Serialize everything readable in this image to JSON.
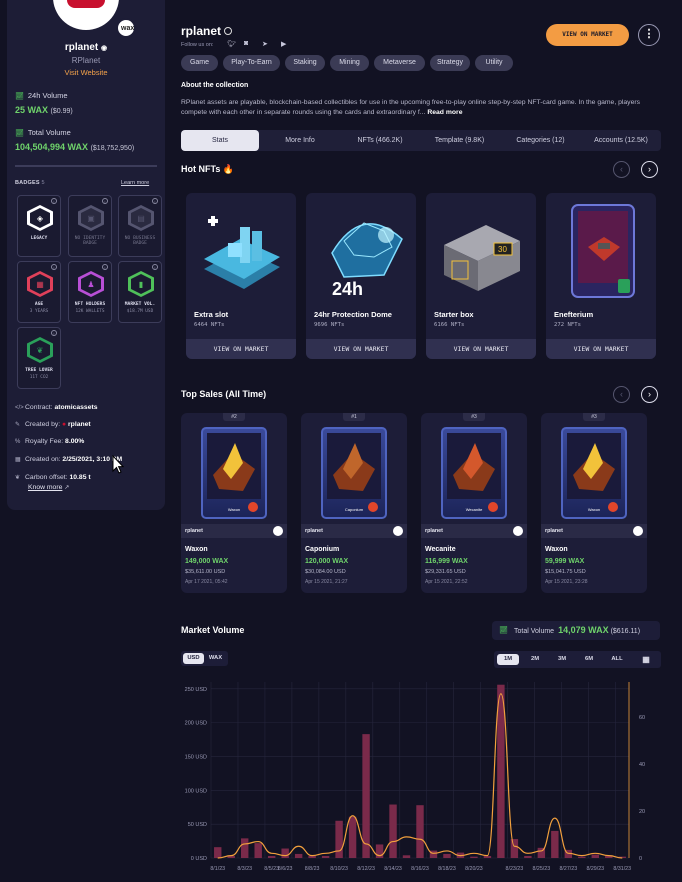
{
  "sidebar": {
    "name": "rplanet",
    "subtitle": "RPlanet",
    "website": "Visit Website",
    "stats": [
      {
        "label": "24h Volume",
        "value": "25 WAX",
        "usd": "($0.99)"
      },
      {
        "label": "Total Volume",
        "value": "104,504,994 WAX",
        "usd": "($18,752,950)"
      }
    ],
    "badges_title": "BADGES",
    "badges_count": "5",
    "learn_more": "Learn more",
    "badges": [
      {
        "label": "LEGACY",
        "sub": "",
        "icon": "legacy-icon",
        "color": "#ffffff",
        "active": true
      },
      {
        "label": "NO IDENTITY BADGE",
        "sub": "",
        "icon": "identity-icon",
        "color": "#555570",
        "active": false
      },
      {
        "label": "NO BUSINESS BADGE",
        "sub": "",
        "icon": "business-icon",
        "color": "#555570",
        "active": false
      },
      {
        "label": "AGE",
        "sub": "3 YEARS",
        "icon": "calendar-icon",
        "color": "#e0405a",
        "active": true
      },
      {
        "label": "NFT HOLDERS",
        "sub": "12K WALLETS",
        "icon": "holders-icon",
        "color": "#b84fd6",
        "active": true
      },
      {
        "label": "MARKET VOL.",
        "sub": "$18.7M USD",
        "icon": "chart-up-icon",
        "color": "#4fc05a",
        "active": true
      },
      {
        "label": "TREE LOVER",
        "sub": "11T CO2",
        "icon": "leaf-icon",
        "color": "#2aa05a",
        "active": true
      }
    ],
    "meta": {
      "contract_label": "Contract:",
      "contract": "atomicassets",
      "created_by_label": "Created by:",
      "created_by": "rplanet",
      "royalty_label": "Royalty Fee:",
      "royalty": "8.00%",
      "created_on_label": "Created on:",
      "created_on": "2/25/2021, 3:10 PM",
      "carbon_label": "Carbon offset:",
      "carbon": "10.85 t",
      "know_more": "Know more"
    }
  },
  "header": {
    "title": "rplanet",
    "follow": "Follow us on:",
    "view_market": "VIEW ON MARKET",
    "more": "⋮",
    "tags": [
      "Game",
      "Play-To-Earn",
      "Staking",
      "Mining",
      "Metaverse",
      "Strategy",
      "Utility"
    ]
  },
  "about": {
    "heading": "About the collection",
    "text": "RPlanet assets are playable, blockchain-based collectibles for use in the upcoming free-to-play online step-by-step NFT-card game. In the game, players compete with each other in separate rounds using the cards and extraordinary f...",
    "read_more": "Read more"
  },
  "tabs": [
    "Stats",
    "More Info",
    "NFTs (466.2K)",
    "Template (9.8K)",
    "Categories (12)",
    "Accounts (12.5K)"
  ],
  "hot": {
    "heading": "Hot NFTs 🔥",
    "cards": [
      {
        "name": "Extra slot",
        "count": "6464 NFTs",
        "button": "VIEW ON MARKET"
      },
      {
        "name": "24hr Protection Dome",
        "count": "9696 NFTs",
        "button": "VIEW ON MARKET"
      },
      {
        "name": "Starter box",
        "count": "6166 NFTs",
        "button": "VIEW ON MARKET"
      },
      {
        "name": "Enefterium",
        "count": "272 NFTs",
        "button": "VIEW ON MARKET"
      }
    ]
  },
  "sales": {
    "heading": "Top Sales (All Time)",
    "items": [
      {
        "rank": "#2",
        "collection": "rplanet",
        "name": "Waxon",
        "wax": "149,000 WAX",
        "usd": "$35,611.00 USD",
        "date": "Apr 17 2021, 05:42",
        "card_label": "Waxon"
      },
      {
        "rank": "#1",
        "collection": "rplanet",
        "name": "Caponium",
        "wax": "120,000 WAX",
        "usd": "$30,084.00 USD",
        "date": "Apr 15 2021, 21:27",
        "card_label": "Caponium"
      },
      {
        "rank": "#3",
        "collection": "rplanet",
        "name": "Wecanite",
        "wax": "116,999 WAX",
        "usd": "$29,331.65 USD",
        "date": "Apr 15 2021, 22:52",
        "card_label": "Wecanite"
      },
      {
        "rank": "#3",
        "collection": "rplanet",
        "name": "Waxon",
        "wax": "59,999 WAX",
        "usd": "$15,041.75 USD",
        "date": "Apr 15 2021, 23:28",
        "card_label": "Waxon"
      }
    ]
  },
  "market": {
    "heading": "Market Volume",
    "total_label": "Total Volume",
    "total_wax": "14,079 WAX",
    "total_usd": "($616.11)",
    "currency": [
      "USD",
      "WAX"
    ],
    "ranges": [
      "1M",
      "2M",
      "3M",
      "6M",
      "ALL"
    ]
  },
  "chart_data": {
    "type": "bar",
    "categories": [
      "8/1/23",
      "8/2/23",
      "8/3/23",
      "8/4/23",
      "8/5/23",
      "8/6/23",
      "8/7/23",
      "8/8/23",
      "8/9/23",
      "8/10/23",
      "8/11/23",
      "8/12/23",
      "8/13/23",
      "8/14/23",
      "8/15/23",
      "8/16/23",
      "8/17/23",
      "8/18/23",
      "8/19/23",
      "8/20/23",
      "8/21/23",
      "8/22/23",
      "8/23/23",
      "8/24/23",
      "8/25/23",
      "8/26/23",
      "8/27/23",
      "8/28/23",
      "8/29/23",
      "8/30/23",
      "8/31/23"
    ],
    "series": [
      {
        "name": "USD",
        "type": "bar",
        "values": [
          16,
          3,
          29,
          22,
          3,
          14,
          6,
          3,
          3,
          55,
          61,
          183,
          20,
          79,
          4,
          78,
          11,
          6,
          8,
          2,
          3,
          256,
          28,
          3,
          15,
          40,
          12,
          2,
          5,
          3,
          2
        ]
      },
      {
        "name": "Sales",
        "type": "line",
        "values": [
          0,
          1,
          6,
          7,
          2,
          1,
          5,
          1,
          2,
          3,
          18,
          6,
          1,
          7,
          9,
          8,
          2,
          3,
          1,
          2,
          1,
          70,
          5,
          2,
          3,
          17,
          2,
          1,
          2,
          1,
          0
        ]
      }
    ],
    "y_ticks": [
      "0 USD",
      "50 USD",
      "100 USD",
      "150 USD",
      "200 USD",
      "250 USD"
    ],
    "y2_ticks": [
      "0",
      "20",
      "40",
      "60"
    ],
    "x_ticks": [
      "8/1/23",
      "8/3/23",
      "8/5/23",
      "8/6/23",
      "8/8/23",
      "8/10/23",
      "8/12/23",
      "8/14/23",
      "8/16/23",
      "8/18/23",
      "8/20/23",
      "8/23/23",
      "8/25/23",
      "8/27/23",
      "8/29/23",
      "8/31/23"
    ],
    "ylim": [
      0,
      260
    ],
    "y2lim": [
      0,
      75
    ],
    "bar_color": "#7a2a4a",
    "line_color": "#f2a03d"
  }
}
